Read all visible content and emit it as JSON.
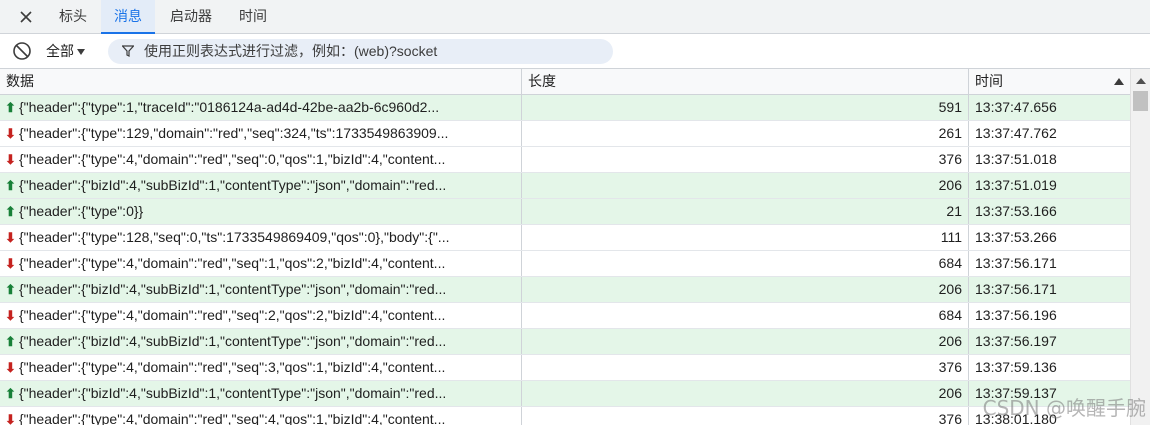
{
  "tabs": {
    "close_icon": "close-icon",
    "headers": "标头",
    "messages": "消息",
    "initiator": "启动器",
    "timing": "时间",
    "active": "messages",
    "accent_color": "#1a73e8"
  },
  "toolbar": {
    "block_icon": "block-icon",
    "filter_select": "全部",
    "filter_placeholder": "使用正则表达式进行过滤，例如：(web)?socket"
  },
  "table": {
    "columns": {
      "data": "数据",
      "length": "长度",
      "time": "时间"
    },
    "sort": "time-ascending",
    "rows": [
      {
        "dir": "sent",
        "data": "{\"header\":{\"type\":1,\"traceId\":\"0186124a-ad4d-42be-aa2b-6c960d2...",
        "length": "591",
        "time": "13:37:47.656"
      },
      {
        "dir": "recv",
        "data": "{\"header\":{\"type\":129,\"domain\":\"red\",\"seq\":324,\"ts\":1733549863909...",
        "length": "261",
        "time": "13:37:47.762"
      },
      {
        "dir": "recv",
        "data": "{\"header\":{\"type\":4,\"domain\":\"red\",\"seq\":0,\"qos\":1,\"bizId\":4,\"content...",
        "length": "376",
        "time": "13:37:51.018"
      },
      {
        "dir": "sent",
        "data": "{\"header\":{\"bizId\":4,\"subBizId\":1,\"contentType\":\"json\",\"domain\":\"red...",
        "length": "206",
        "time": "13:37:51.019"
      },
      {
        "dir": "sent",
        "data": "{\"header\":{\"type\":0}}",
        "length": "21",
        "time": "13:37:53.166"
      },
      {
        "dir": "recv",
        "data": "{\"header\":{\"type\":128,\"seq\":0,\"ts\":1733549869409,\"qos\":0},\"body\":{\"...",
        "length": "111",
        "time": "13:37:53.266"
      },
      {
        "dir": "recv",
        "data": "{\"header\":{\"type\":4,\"domain\":\"red\",\"seq\":1,\"qos\":2,\"bizId\":4,\"content...",
        "length": "684",
        "time": "13:37:56.171"
      },
      {
        "dir": "sent",
        "data": "{\"header\":{\"bizId\":4,\"subBizId\":1,\"contentType\":\"json\",\"domain\":\"red...",
        "length": "206",
        "time": "13:37:56.171"
      },
      {
        "dir": "recv",
        "data": "{\"header\":{\"type\":4,\"domain\":\"red\",\"seq\":2,\"qos\":2,\"bizId\":4,\"content...",
        "length": "684",
        "time": "13:37:56.196"
      },
      {
        "dir": "sent",
        "data": "{\"header\":{\"bizId\":4,\"subBizId\":1,\"contentType\":\"json\",\"domain\":\"red...",
        "length": "206",
        "time": "13:37:56.197"
      },
      {
        "dir": "recv",
        "data": "{\"header\":{\"type\":4,\"domain\":\"red\",\"seq\":3,\"qos\":1,\"bizId\":4,\"content...",
        "length": "376",
        "time": "13:37:59.136"
      },
      {
        "dir": "sent",
        "data": "{\"header\":{\"bizId\":4,\"subBizId\":1,\"contentType\":\"json\",\"domain\":\"red...",
        "length": "206",
        "time": "13:37:59.137"
      },
      {
        "dir": "recv",
        "data": "{\"header\":{\"type\":4,\"domain\":\"red\",\"seq\":4,\"qos\":1,\"bizId\":4,\"content...",
        "length": "376",
        "time": "13:38:01.180"
      }
    ],
    "sent_arrow": "⬆",
    "recv_arrow": "⬇",
    "sent_color": "#e4f6e8"
  },
  "watermark": "CSDN @唤醒手腕"
}
